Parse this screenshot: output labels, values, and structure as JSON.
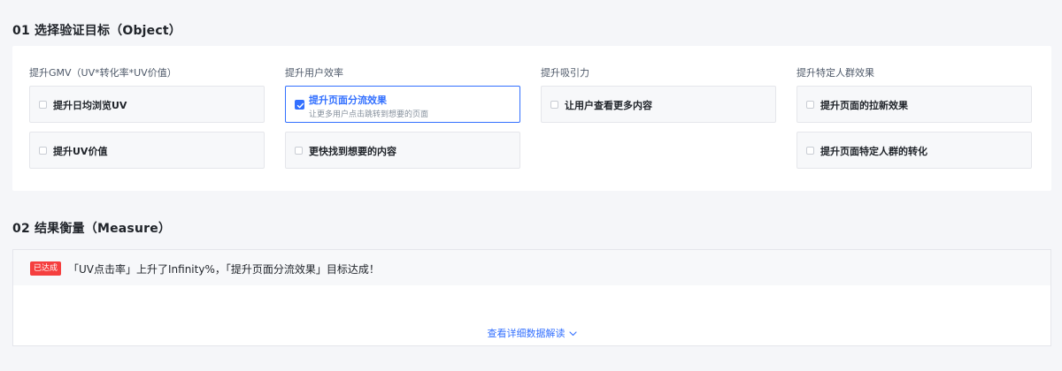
{
  "object": {
    "title": "01 选择验证目标（Object）",
    "groups": [
      {
        "label": "提升GMV（UV*转化率*UV价值）",
        "options": [
          {
            "label": "提升日均浏览UV",
            "checked": false
          },
          {
            "label": "提升UV价值",
            "checked": false
          }
        ]
      },
      {
        "label": "提升用户效率",
        "options": [
          {
            "label": "提升页面分流效果",
            "desc": "让更多用户点击跳转到想要的页面",
            "checked": true
          },
          {
            "label": "更快找到想要的内容",
            "checked": false
          }
        ]
      },
      {
        "label": "提升吸引力",
        "options": [
          {
            "label": "让用户查看更多内容",
            "checked": false
          }
        ]
      },
      {
        "label": "提升特定人群效果",
        "options": [
          {
            "label": "提升页面的拉新效果",
            "checked": false
          },
          {
            "label": "提升页面特定人群的转化",
            "checked": false
          }
        ]
      }
    ]
  },
  "measure": {
    "title": "02 结果衡量（Measure）",
    "badge": "已达成",
    "result_text": "「UV点击率」上升了Infinity%，「提升页面分流效果」目标达成！",
    "detail_link": "查看详细数据解读"
  },
  "colors": {
    "accent": "#3370ff",
    "badge": "#f53f3f",
    "background": "#f5f6f9"
  }
}
